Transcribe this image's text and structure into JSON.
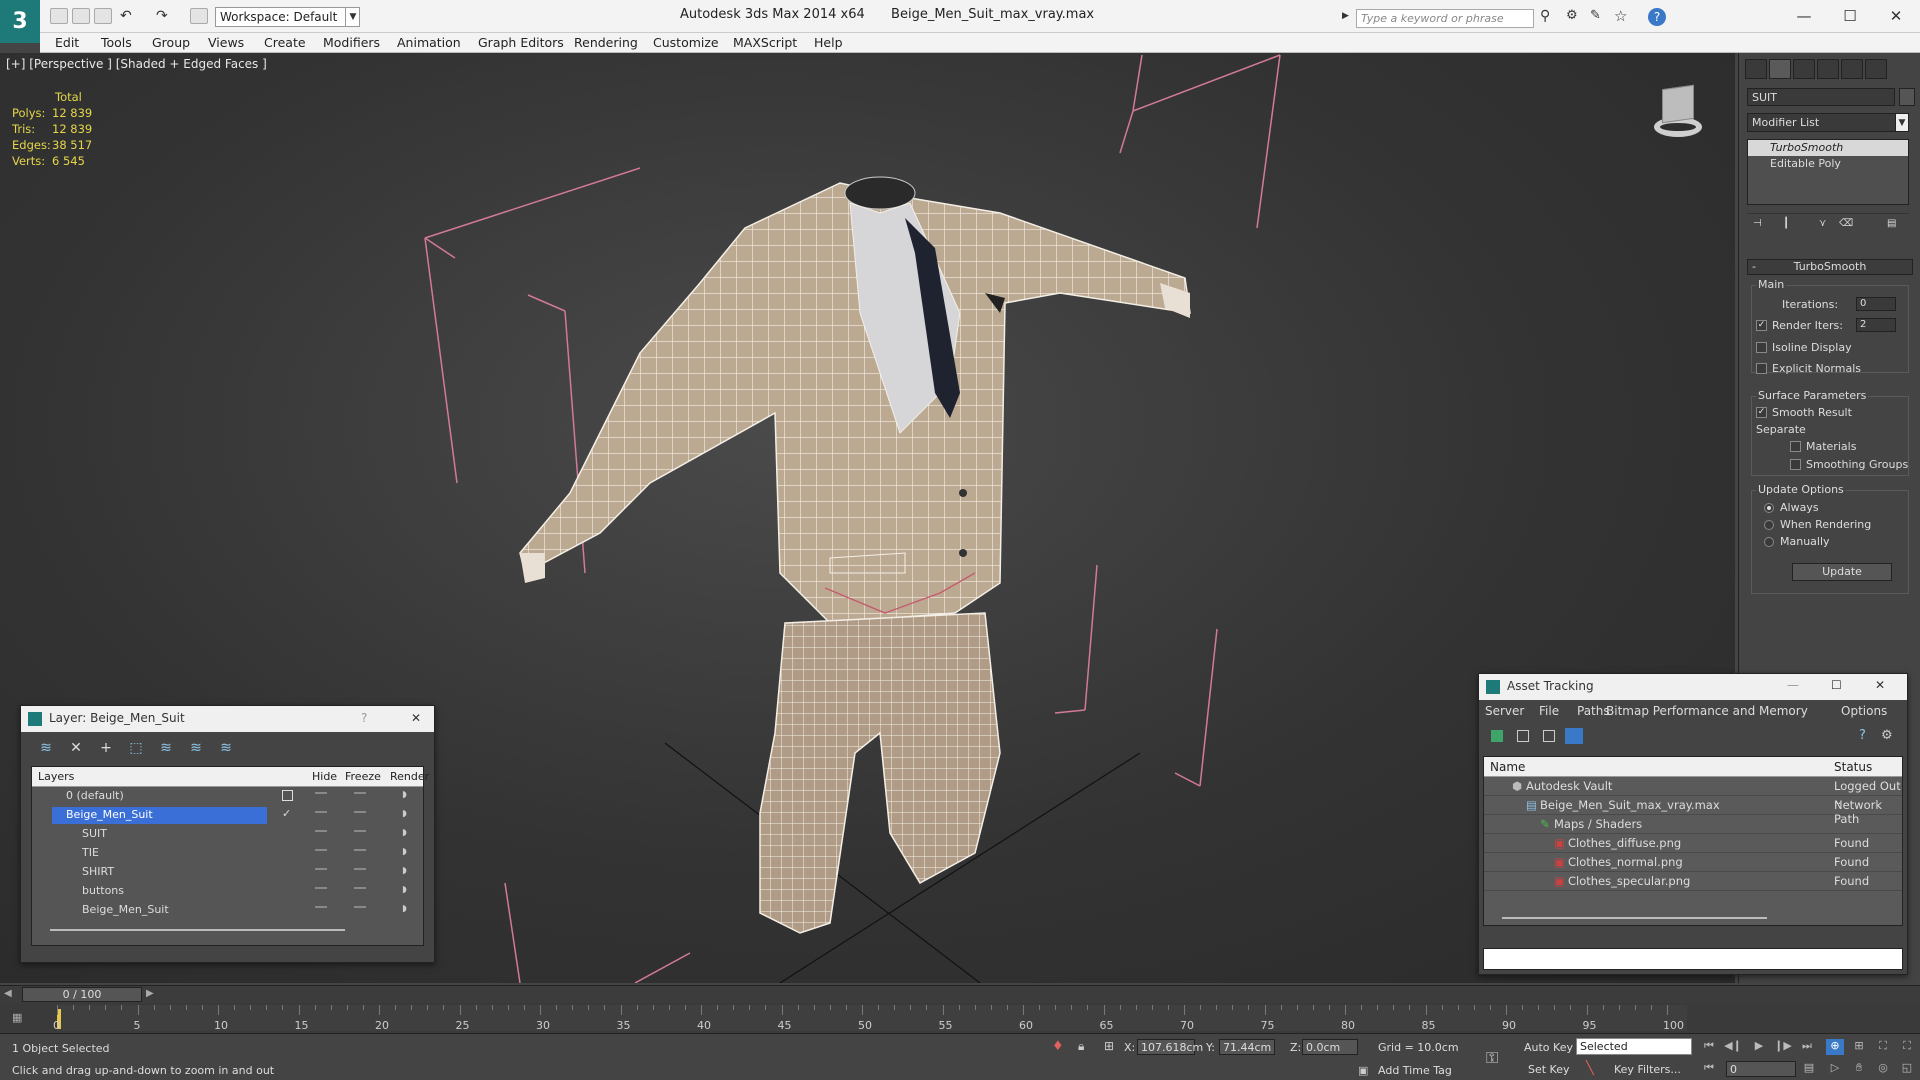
{
  "titlebar": {
    "logo": "3",
    "workspace": "Workspace: Default",
    "app_name": "Autodesk 3ds Max  2014 x64",
    "file_name": "Beige_Men_Suit_max_vray.max",
    "search_placeholder": "Type a keyword or phrase"
  },
  "menu": [
    "Edit",
    "Tools",
    "Group",
    "Views",
    "Create",
    "Modifiers",
    "Animation",
    "Graph Editors",
    "Rendering",
    "Customize",
    "MAXScript",
    "Help"
  ],
  "viewport": {
    "label": "[+] [Perspective ] [Shaded + Edged Faces ]",
    "stats": {
      "header": "Total",
      "rows": [
        {
          "k": "Polys:",
          "v": "12 839"
        },
        {
          "k": "Tris:",
          "v": "12 839"
        },
        {
          "k": "Edges:",
          "v": "38 517"
        },
        {
          "k": "Verts:",
          "v": "6 545"
        }
      ]
    }
  },
  "command_panel": {
    "object_name": "SUIT",
    "modifier_list": "Modifier List",
    "stack": [
      "TurboSmooth",
      "Editable Poly"
    ],
    "rollout_title": "TurboSmooth",
    "main": {
      "title": "Main",
      "iterations_label": "Iterations:",
      "iterations_value": "0",
      "render_iters_label": "Render Iters:",
      "render_iters_value": "2",
      "isoline": "Isoline Display",
      "explicit_normals": "Explicit Normals"
    },
    "surface": {
      "title": "Surface Parameters",
      "smooth_result": "Smooth Result",
      "separate": "Separate",
      "materials": "Materials",
      "smoothing_groups": "Smoothing Groups"
    },
    "update_options": {
      "title": "Update Options",
      "always": "Always",
      "when_rendering": "When Rendering",
      "manually": "Manually",
      "update_button": "Update"
    }
  },
  "layer_dialog": {
    "title": "Layer: Beige_Men_Suit",
    "help": "?",
    "close": "✕",
    "columns": {
      "layers": "Layers",
      "hide": "Hide",
      "freeze": "Freeze",
      "render": "Render"
    },
    "rows": [
      {
        "name": "0 (default)",
        "indent": 1
      },
      {
        "name": "Beige_Men_Suit",
        "indent": 1
      },
      {
        "name": "SUIT",
        "indent": 2
      },
      {
        "name": "TIE",
        "indent": 2
      },
      {
        "name": "SHIRT",
        "indent": 2
      },
      {
        "name": "buttons",
        "indent": 2
      },
      {
        "name": "Beige_Men_Suit",
        "indent": 2
      }
    ]
  },
  "asset_dialog": {
    "title": "Asset Tracking",
    "menu": [
      "Server",
      "File",
      "Paths",
      "Bitmap Performance and Memory",
      "Options"
    ],
    "columns": {
      "name": "Name",
      "status": "Status"
    },
    "rows": [
      {
        "name": "Autodesk Vault",
        "status": "Logged Out ..",
        "indent": 1
      },
      {
        "name": "Beige_Men_Suit_max_vray.max",
        "status": "Network Path",
        "indent": 2
      },
      {
        "name": "Maps / Shaders",
        "status": "",
        "indent": 3
      },
      {
        "name": "Clothes_diffuse.png",
        "status": "Found",
        "indent": 4
      },
      {
        "name": "Clothes_normal.png",
        "status": "Found",
        "indent": 4
      },
      {
        "name": "Clothes_specular.png",
        "status": "Found",
        "indent": 4
      }
    ]
  },
  "timeline": {
    "frame": "0 / 100",
    "ticks": [
      "0",
      "5",
      "10",
      "15",
      "20",
      "25",
      "30",
      "35",
      "40",
      "45",
      "50",
      "55",
      "60",
      "65",
      "70",
      "75",
      "80",
      "85",
      "90",
      "95",
      "100"
    ]
  },
  "status": {
    "selection": "1 Object Selected",
    "prompt": "Click and drag up-and-down to zoom in and out",
    "x_label": "X:",
    "x": "107.618cm",
    "y_label": "Y:",
    "y": "71.44cm",
    "z_label": "Z:",
    "z": "0.0cm",
    "grid": "Grid = 10.0cm",
    "auto_key": "Auto Key",
    "set_key": "Set Key",
    "selected": "Selected",
    "key_filters": "Key Filters...",
    "add_time_tag": "Add Time Tag",
    "frame_field": "0"
  }
}
